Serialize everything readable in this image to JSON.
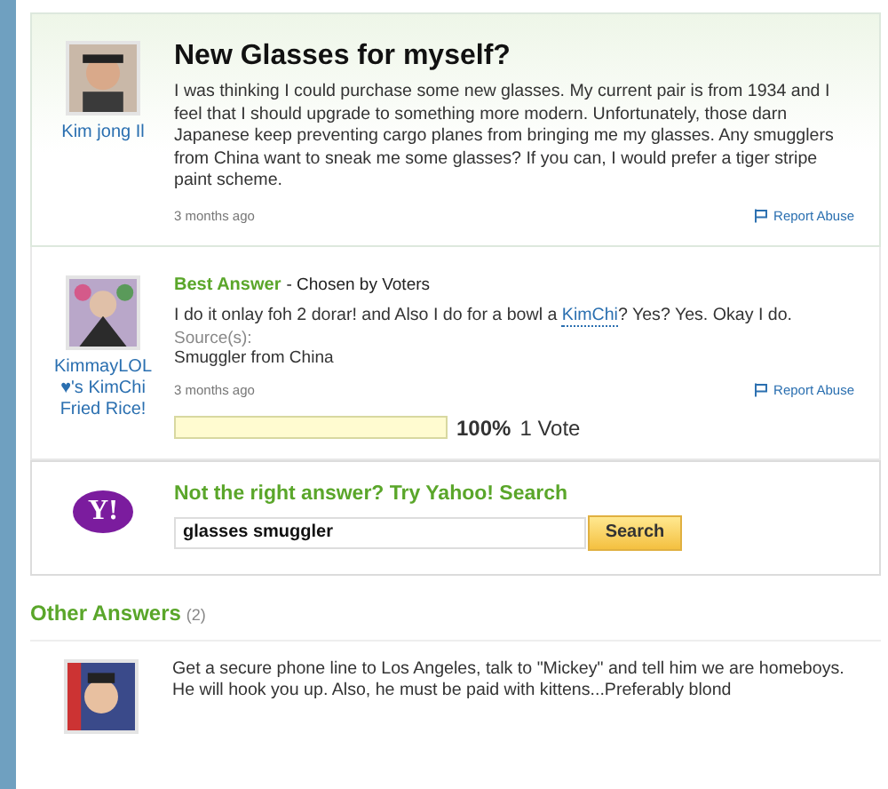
{
  "question": {
    "asker": "Kim jong Il",
    "title": "New Glasses for myself?",
    "body": "I was thinking I could purchase some new glasses. My current pair is from 1934 and I feel that I should upgrade to something more modern. Unfortunately, those darn Japanese keep preventing cargo planes from bringing me my glasses. Any smugglers from China want to sneak me some glasses? If you can, I would prefer a tiger stripe paint scheme.",
    "time": "3 months ago",
    "report": "Report Abuse"
  },
  "best_answer": {
    "user": "KimmayLOL ♥'s KimChi Fried Rice!",
    "label": "Best Answer",
    "chosen": "- Chosen by Voters",
    "text_before": "I do it onlay foh 2 dorar! and Also I do for a bowl a",
    "link": "KimChi",
    "text_after": "? Yes? Yes. Okay I do.",
    "source_label": "Source(s):",
    "source": "Smuggler from China",
    "time": "3 months ago",
    "report": "Report Abuse",
    "level": 1,
    "percent": "100%",
    "votes": "1 Vote"
  },
  "search": {
    "logo": "Y!",
    "prompt": "Not the right answer? Try Yahoo! Search",
    "value": "glasses smuggler",
    "button": "Search"
  },
  "other_answers": {
    "title": "Other Answers",
    "count": "(2)",
    "answers": [
      {
        "text": "Get a secure phone line to Los Angeles, talk to \"Mickey\" and tell him we are homeboys. He will hook you up. Also, he must be paid with kittens...Preferably blond"
      }
    ]
  }
}
